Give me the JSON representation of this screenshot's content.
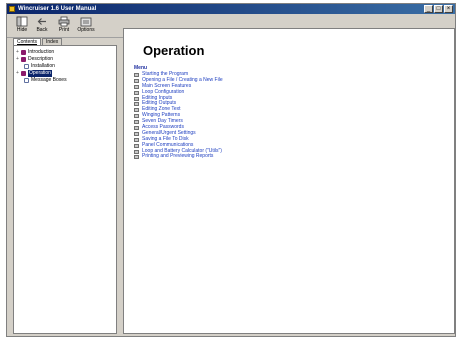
{
  "window": {
    "title": "Wincruiser 1.6 User Manual",
    "controls": [
      "_",
      "□",
      "×"
    ]
  },
  "toolbar": {
    "items": [
      {
        "label": "Hide",
        "icon": "hide-icon"
      },
      {
        "label": "Back",
        "icon": "back-arrow-icon"
      },
      {
        "label": "Print",
        "icon": "printer-icon"
      },
      {
        "label": "Options",
        "icon": "options-icon"
      }
    ]
  },
  "tabs": [
    {
      "label": "Contents",
      "active": true
    },
    {
      "label": "Index",
      "active": false
    }
  ],
  "tree": [
    {
      "label": "Introduction",
      "type": "book",
      "expander": "+"
    },
    {
      "label": "Description",
      "type": "book",
      "expander": "+"
    },
    {
      "label": "Installation",
      "type": "page",
      "expander": ""
    },
    {
      "label": "Operation",
      "type": "book",
      "expander": "+",
      "selected": true
    },
    {
      "label": "Message Boxes",
      "type": "page",
      "expander": ""
    }
  ],
  "content": {
    "title": "Operation",
    "subheading": "Menu",
    "links": [
      "Starting the Program",
      "Opening a File / Creating a New File",
      "Main Screen Features",
      "Loop Configuration",
      "Editing Inputs",
      "Editing Outputs",
      "Editing Zone Text",
      "Winging Patterns",
      "Seven Day Timers",
      "Access Passwords",
      "General/Urgent Settings",
      "Saving a File To Disk",
      "Panel Communications",
      "Loop and Battery Calculator (\"Utils\")",
      "Printing and Previewing Reports"
    ]
  }
}
